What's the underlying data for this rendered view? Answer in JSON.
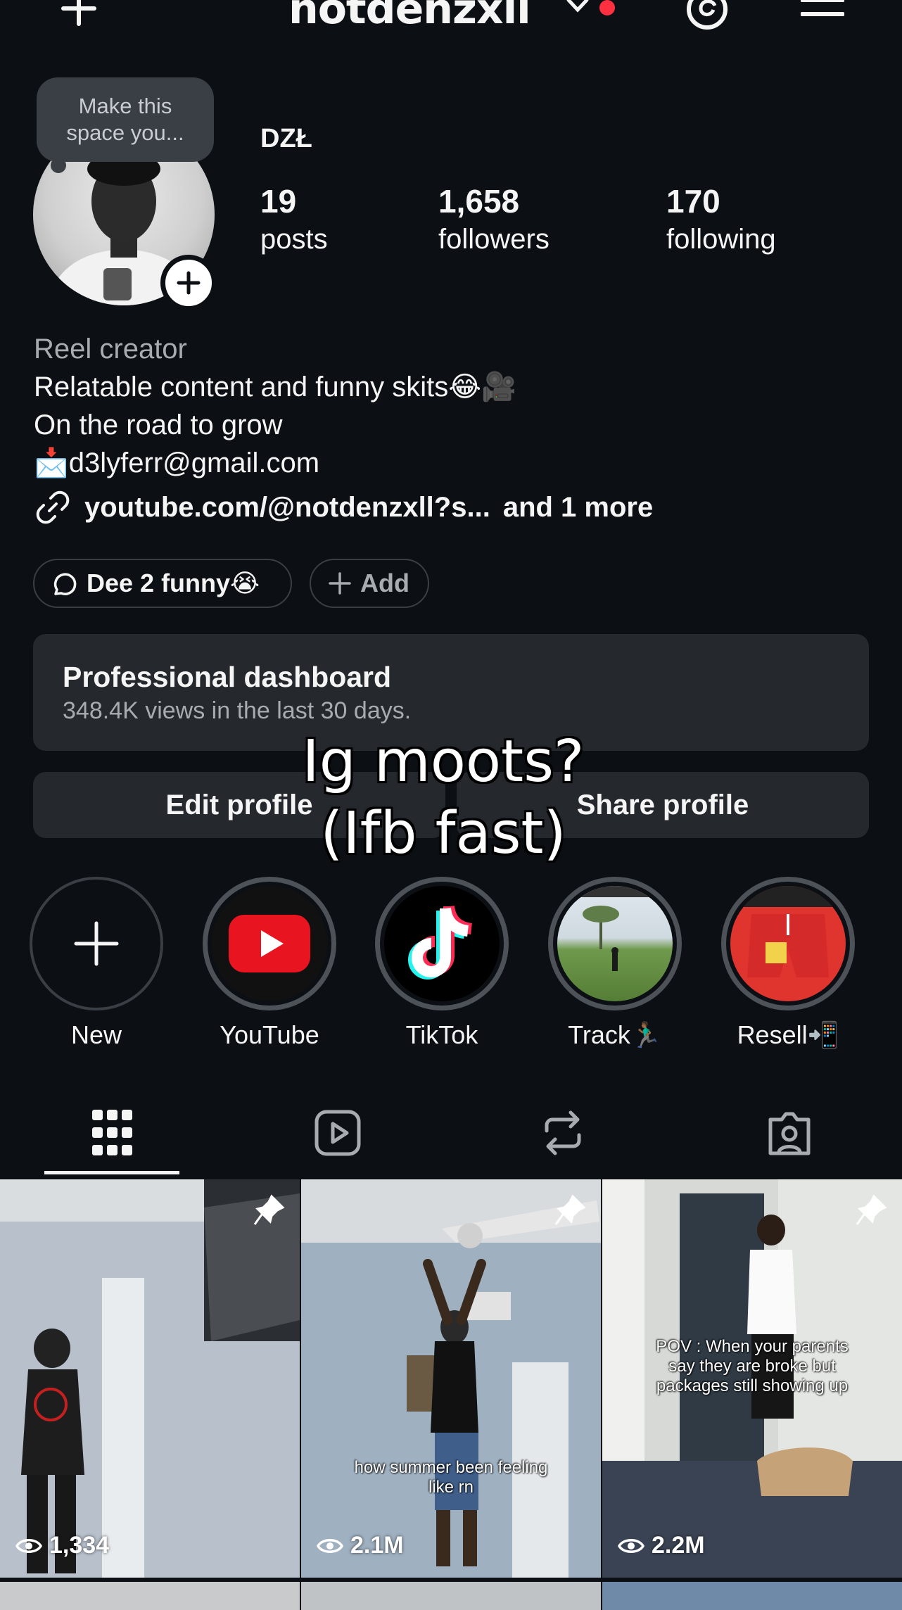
{
  "header": {
    "username": "notdenzxll"
  },
  "profile": {
    "note": "Make this space you...",
    "display_name": "DZŁ",
    "stats": [
      {
        "value": "19",
        "label": "posts"
      },
      {
        "value": "1,658",
        "label": "followers"
      },
      {
        "value": "170",
        "label": "following"
      }
    ],
    "bio": {
      "category": "Reel creator",
      "lines": [
        "Relatable content and funny skits😂🎥",
        "On the road to grow",
        "📩d3lyferr@gmail.com"
      ]
    },
    "link": {
      "text": "youtube.com/@notdenzxll?s...",
      "more": "and 1 more"
    }
  },
  "chips": {
    "threads_label": "Dee 2 funny😭",
    "add_label": "Add"
  },
  "dashboard": {
    "title": "Professional dashboard",
    "subtitle": "348.4K views in the last 30 days."
  },
  "buttons": {
    "edit": "Edit profile",
    "share": "Share profile"
  },
  "overlay_caption": {
    "line1": "Ig moots?",
    "line2": "(Ifb fast)"
  },
  "highlights": [
    {
      "label": "New",
      "icon": "plus-icon"
    },
    {
      "label": "YouTube",
      "icon": "youtube-icon"
    },
    {
      "label": "TikTok",
      "icon": "tiktok-icon"
    },
    {
      "label": "Track🏃🏾‍♂️",
      "icon": "photo"
    },
    {
      "label": "Resell📲",
      "icon": "photo"
    }
  ],
  "tabs": [
    "grid-icon",
    "reels-icon",
    "reposts-icon",
    "tagged-icon"
  ],
  "posts": [
    {
      "views": "1,334",
      "caption": "",
      "pinned": true
    },
    {
      "views": "2.1M",
      "caption": "how summer been feeling like rn",
      "pinned": true
    },
    {
      "views": "2.2M",
      "caption": "POV : When your parents say they are broke but packages still showing up",
      "pinned": true
    }
  ],
  "colors": {
    "background": "#0c1014",
    "surface": "#25292e",
    "muted_text": "#a8acb1",
    "notification_dot": "#ff3040"
  }
}
